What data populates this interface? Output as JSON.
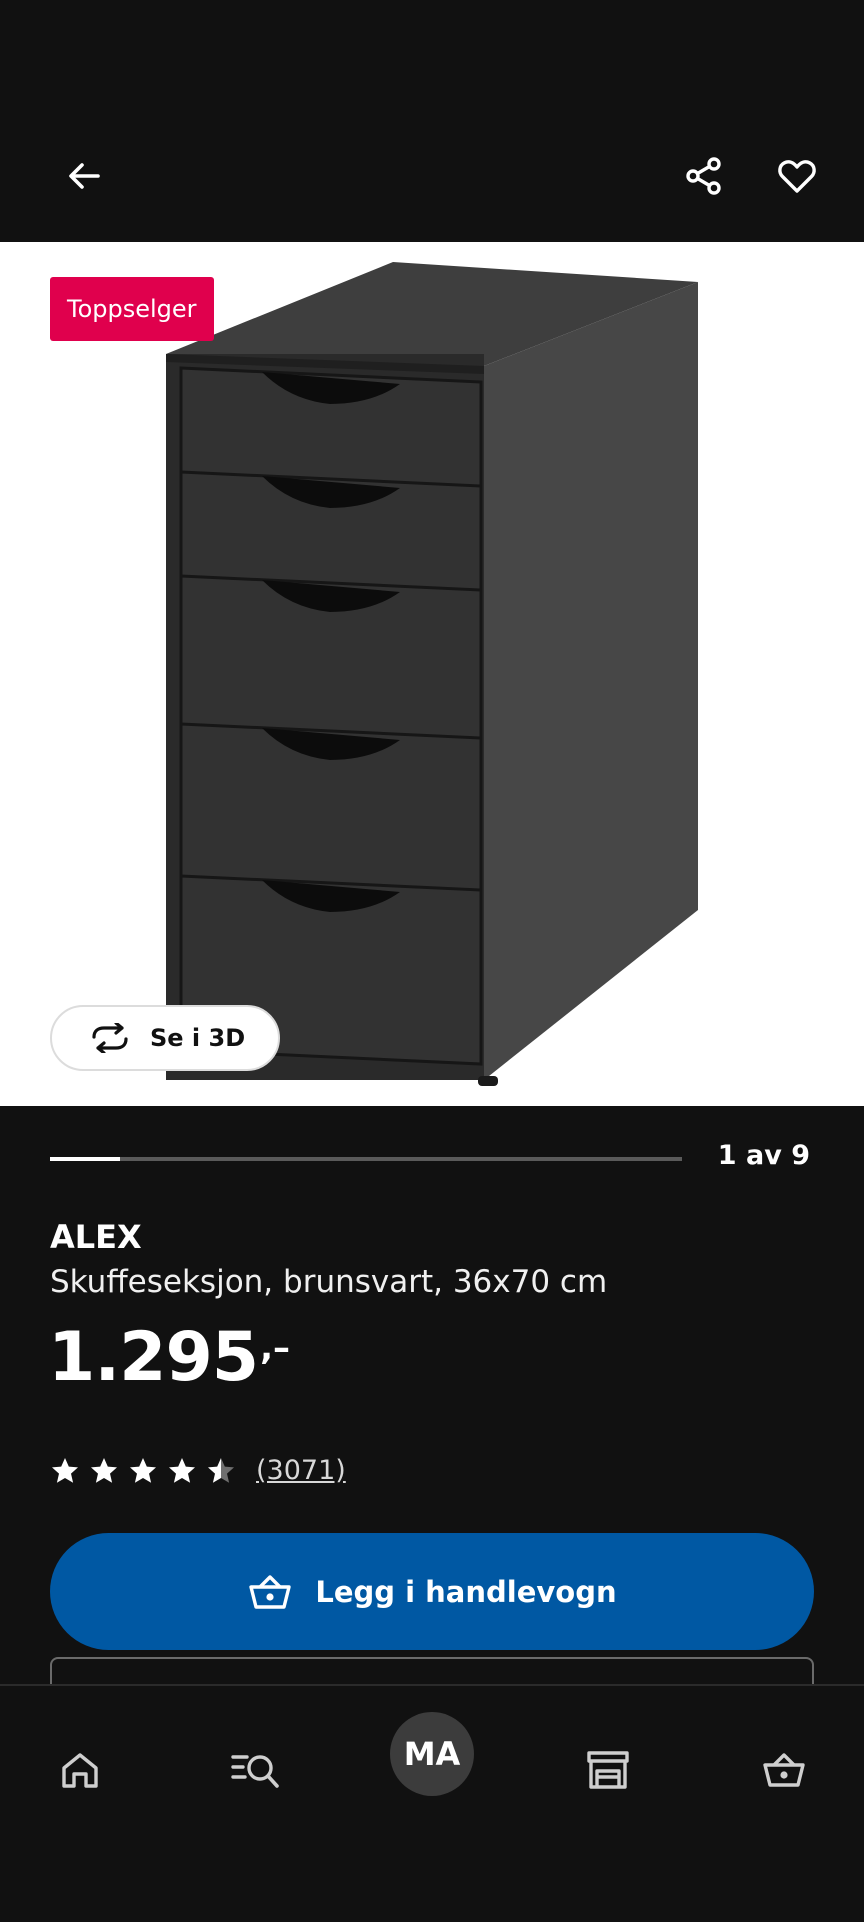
{
  "header": {
    "back_icon": "arrow-left-icon",
    "share_icon": "share-icon",
    "favourite_icon": "heart-icon"
  },
  "gallery": {
    "badge": "Toppselger",
    "view_3d_label": "Se i 3D",
    "counter": "1 av 9",
    "progress_fraction": 0.111
  },
  "product": {
    "name": "ALEX",
    "description": "Skuffeseksjon, brunsvart, 36x70 cm",
    "price": "1.295",
    "price_suffix": ",–",
    "rating": 4.5,
    "review_count": "(3071)"
  },
  "actions": {
    "add_to_cart_label": "Legg i handlevogn"
  },
  "bottom_nav": {
    "home_icon": "home-icon",
    "search_icon": "search-list-icon",
    "avatar_initials": "MA",
    "store_icon": "store-icon",
    "cart_icon": "basket-icon"
  },
  "colors": {
    "background": "#111111",
    "badge": "#e0004d",
    "primary_button": "#0058a3"
  }
}
